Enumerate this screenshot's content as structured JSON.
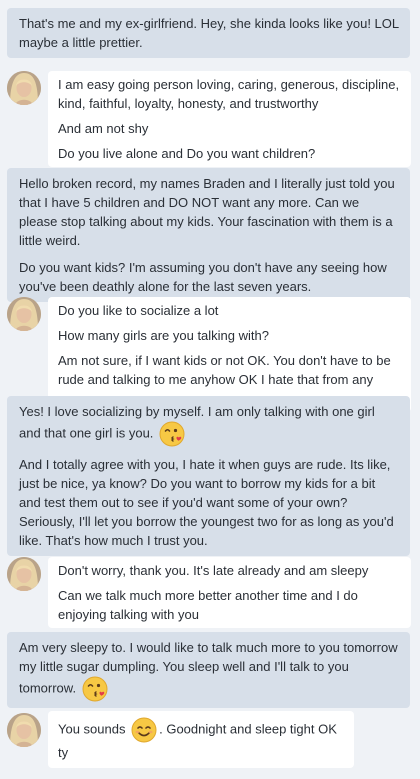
{
  "messages": [
    {
      "from": "them",
      "lines": [
        "That's me and my ex-girlfriend. Hey, she kinda looks like you! LOL maybe a little prettier."
      ]
    },
    {
      "from": "me",
      "lines": [
        "I am easy going person loving, caring, generous, discipline, kind, faithful, loyalty, honesty, and trustworthy",
        "And am not shy",
        "Do you live alone and Do you want children?"
      ]
    },
    {
      "from": "them",
      "lines": [
        "Hello broken record, my names Braden and I literally just told you that I have 5 children and DO NOT want any more. Can we please stop talking about my kids. Your fascination with them is a little weird.",
        "Do you want kids? I'm assuming you don't have any seeing how you've been deathly alone for the last seven years."
      ]
    },
    {
      "from": "me",
      "lines": [
        "Do you like to socialize a lot",
        "How many girls are you talking with?",
        "Am not sure, if I want kids or not OK. You don't have to be rude and talking to me anyhow OK I hate that from any guys"
      ]
    },
    {
      "from": "them",
      "lines": [
        "Yes! I love socializing by myself. I am only talking with one girl and that one girl is you.",
        "And I totally agree with you, I hate it when guys are rude. Its like, just be nice, ya know? Do you want to borrow my kids for a bit and test them out to see if you'd want some of your own? Seriously, I'll let you borrow the youngest two for as long as you'd like. That's how much I trust you."
      ]
    },
    {
      "from": "me",
      "lines": [
        "Don't worry, thank you. It's late already and am sleepy",
        "Can we talk much more better another time and I do enjoying talking with you"
      ]
    },
    {
      "from": "them",
      "lines": [
        "Am very sleepy to. I would like to talk much more to you tomorrow my little sugar dumpling. You sleep well and I'll talk to you tomorrow."
      ]
    },
    {
      "from": "me",
      "lines": [
        "You sounds",
        ". Goodnight and sleep tight OK ty"
      ]
    }
  ],
  "icons": {
    "kiss": "face-blowing-kiss-icon",
    "smile": "smiling-face-icon",
    "avatar": "user-avatar"
  },
  "colors": {
    "background": "#eff2f6",
    "them_bubble": "#d7dfe9",
    "me_bubble": "#ffffff",
    "text": "#2a2f36"
  }
}
